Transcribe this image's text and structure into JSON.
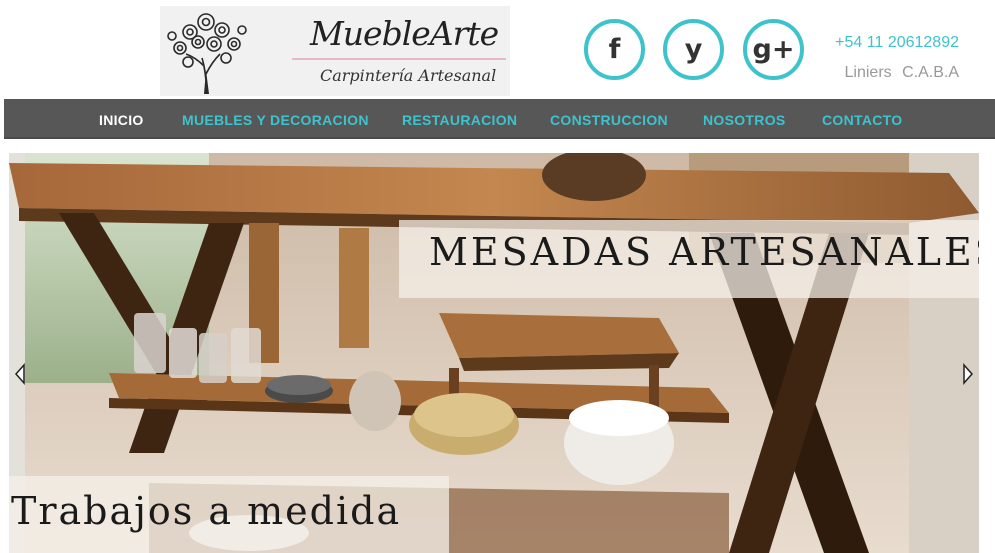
{
  "brand": {
    "name": "MuebleArte",
    "tagline": "Carpintería Artesanal"
  },
  "social": {
    "facebook": {
      "glyph": "f",
      "icon": "facebook-icon"
    },
    "youtube": {
      "glyph": "y",
      "icon": "youtube-icon"
    },
    "googleplus": {
      "glyph": "g+",
      "icon": "google-plus-icon"
    }
  },
  "contact": {
    "phone": "+54 11 20612892",
    "location": "Liniers C.A.B.A"
  },
  "nav": {
    "items": [
      {
        "label": "INICIO",
        "active": true
      },
      {
        "label": "MUEBLES Y DECORACION",
        "active": false
      },
      {
        "label": "RESTAURACION",
        "active": false
      },
      {
        "label": "CONSTRUCCION",
        "active": false
      },
      {
        "label": "NOSOTROS",
        "active": false
      },
      {
        "label": "CONTACTO",
        "active": false
      }
    ]
  },
  "slider": {
    "caption_top": "MESADAS ARTESANALES",
    "caption_bottom": "Trabajos a medida"
  },
  "colors": {
    "accent": "#3ec3cc",
    "nav_bg": "#575757",
    "muted_text": "#999999"
  }
}
